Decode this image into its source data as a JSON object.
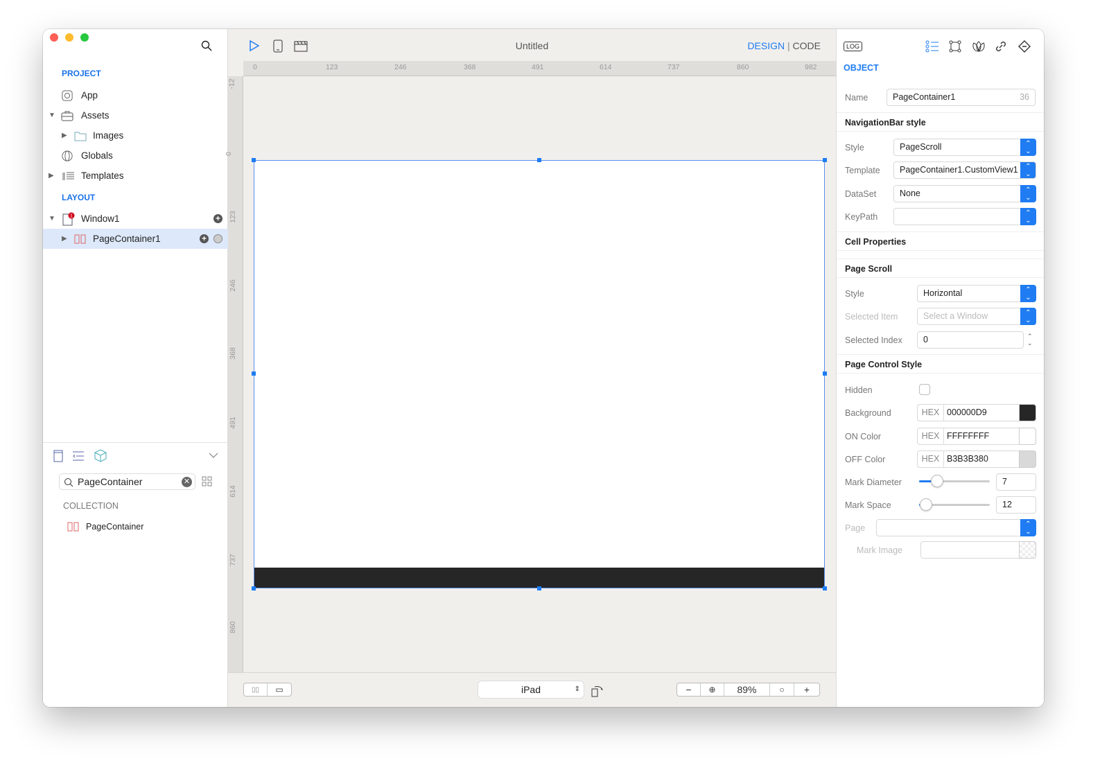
{
  "window": {
    "title": "Untitled"
  },
  "toolbar": {
    "design": "DESIGN",
    "separator": "|",
    "code": "CODE"
  },
  "sidebar": {
    "project_label": "PROJECT",
    "project_items": [
      {
        "label": "App",
        "icon": "app-icon"
      },
      {
        "label": "Assets",
        "icon": "briefcase-icon"
      },
      {
        "label": "Images",
        "icon": "folder-icon"
      },
      {
        "label": "Globals",
        "icon": "globe-icon"
      },
      {
        "label": "Templates",
        "icon": "templates-icon"
      }
    ],
    "layout_label": "LAYOUT",
    "layout_items": [
      {
        "label": "Window1",
        "badge": "1"
      },
      {
        "label": "PageContainer1"
      }
    ],
    "search_value": "PageContainer",
    "collection_label": "COLLECTION",
    "collection_items": [
      {
        "label": "PageContainer"
      }
    ]
  },
  "ruler": {
    "top": [
      "0",
      "123",
      "246",
      "368",
      "491",
      "614",
      "737",
      "860",
      "982"
    ],
    "left": [
      "-12",
      "0",
      "123",
      "246",
      "368",
      "491",
      "614",
      "737",
      "860"
    ]
  },
  "bottom": {
    "device": "iPad",
    "zoom": "89%",
    "zoom_out": "−",
    "zoom_in": "+"
  },
  "inspector": {
    "log": "LOG",
    "section": "OBJECT",
    "name_label": "Name",
    "name_value": "PageContainer1",
    "name_count": "36",
    "navbar_header": "NavigationBar style",
    "style_label": "Style",
    "style_value": "PageScroll",
    "template_label": "Template",
    "template_value": "PageContainer1.CustomView1",
    "dataset_label": "DataSet",
    "dataset_value": "None",
    "keypath_label": "KeyPath",
    "keypath_value": "",
    "cell_header": "Cell Properties",
    "pagescroll_header": "Page Scroll",
    "ps_style_label": "Style",
    "ps_style_value": "Horizontal",
    "selected_item_label": "Selected Item",
    "selected_item_placeholder": "Select a Window",
    "selected_index_label": "Selected Index",
    "selected_index_value": "0",
    "pagecontrol_header": "Page Control Style",
    "hidden_label": "Hidden",
    "hidden_checked": false,
    "hex": "HEX",
    "background_label": "Background",
    "background_value": "000000D9",
    "background_color": "#262626",
    "on_label": "ON Color",
    "on_value": "FFFFFFFF",
    "on_color": "#ffffff",
    "off_label": "OFF Color",
    "off_value": "B3B3B380",
    "off_color": "#d9d9d9",
    "diameter_label": "Mark Diameter",
    "diameter_value": "7",
    "diameter_fraction": 0.25,
    "space_label": "Mark Space",
    "space_value": "12",
    "space_fraction": 0.1,
    "page_label": "Page",
    "page_value": "",
    "mark_image_label": "Mark Image",
    "mark_image_value": ""
  },
  "colors": {
    "accent": "#1f7cf2",
    "selection": "#dde8fa",
    "page_control_bar": "#262626"
  }
}
